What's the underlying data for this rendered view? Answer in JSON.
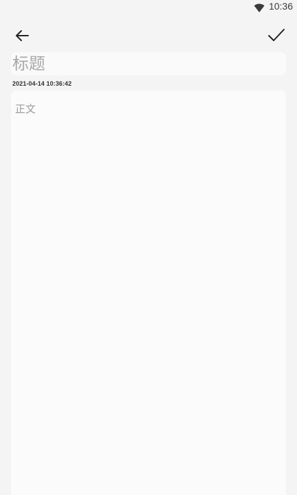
{
  "status_bar": {
    "time": "10:36",
    "wifi_icon": "wifi-icon"
  },
  "toolbar": {
    "back_icon": "arrow-left-icon",
    "confirm_icon": "check-icon"
  },
  "editor": {
    "title_placeholder": "标题",
    "title_value": "",
    "timestamp": "2021-04-14 10:36:42",
    "body_placeholder": "正文",
    "body_value": ""
  },
  "colors": {
    "background": "#f4f4f4",
    "field_background": "#fafafa",
    "placeholder": "#a9a9a9"
  }
}
